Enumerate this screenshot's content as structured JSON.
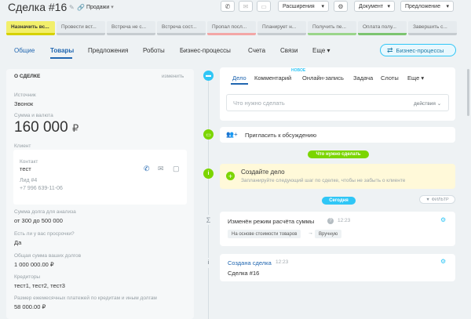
{
  "header": {
    "title": "Сделка #16",
    "funnel": "Продажи",
    "extensions": "Расширения",
    "document": "Документ",
    "proposal": "Предложение"
  },
  "stages": [
    {
      "label": "Назначить вс...",
      "bg": "#f2ef6b",
      "bar": "#d6d100",
      "color": "#333"
    },
    {
      "label": "Провести вст...",
      "bg": "#e6ebee",
      "bar": "#c6ccd0",
      "color": "#666"
    },
    {
      "label": "Встреча не с...",
      "bg": "#e6ebee",
      "bar": "#c6ccd0",
      "color": "#666"
    },
    {
      "label": "Встреча сост...",
      "bg": "#e6ebee",
      "bar": "#c6ccd0",
      "color": "#666"
    },
    {
      "label": "Пропал посл...",
      "bg": "#e6ebee",
      "bar": "#f3a6a6",
      "color": "#666"
    },
    {
      "label": "Планирует н...",
      "bg": "#e6ebee",
      "bar": "#c6ccd0",
      "color": "#666"
    },
    {
      "label": "Получить пе...",
      "bg": "#e6ebee",
      "bar": "#9ad58b",
      "color": "#666"
    },
    {
      "label": "Оплата полу...",
      "bg": "#e6ebee",
      "bar": "#7cc470",
      "color": "#666"
    },
    {
      "label": "Завершить с...",
      "bg": "#e6ebee",
      "bar": "#c6ccd0",
      "color": "#666"
    }
  ],
  "tabs": [
    "Общие",
    "Товары",
    "Предложения",
    "Роботы",
    "Бизнес-процессы",
    "Счета",
    "Связи",
    "Еще"
  ],
  "bp_button": "Бизнес-процессы",
  "left": {
    "section_title": "О СДЕЛКЕ",
    "edit": "изменить",
    "source_label": "Источник",
    "source_value": "Звонок",
    "amount_label": "Сумма и валюта",
    "amount_value": "160 000",
    "currency": "₽",
    "client_label": "Клиент",
    "contact_label": "Контакт",
    "contact_name": "тест",
    "lead": "Лид #4",
    "phone": "+7 996 639-11-06",
    "debt_label": "Сумма долга для анализа",
    "debt_value": "от 300 до 500 000",
    "overdue_label": "Есть ли у вас просрочки?",
    "overdue_value": "Да",
    "total_debt_label": "Общая сумма ваших долгов",
    "total_debt_value": "1 000 000.00 ₽",
    "creditors_label": "Кредиторы",
    "creditors_value": "тест1, тест2, тест3",
    "monthly_label": "Размер ежемесячных платежей по кредитам и иным долгам",
    "monthly_value": "58 000.00 ₽"
  },
  "editor": {
    "tabs": [
      "Дело",
      "Комментарий",
      "Онлайн-запись",
      "Задача",
      "Слоты",
      "Еще"
    ],
    "new_badge": "НОВОЕ",
    "placeholder": "Что нужно сделать",
    "actions": "действия"
  },
  "invite": "Пригласить к обсуждению",
  "chip_todo": "Что нужно сделать",
  "create_task": {
    "title": "Создайте дело",
    "subtitle": "Запланируйте следующий шаг по сделке, чтобы не забыть о клиенте"
  },
  "chip_today": "Сегодня",
  "filter": "ФИЛЬТР",
  "event1": {
    "title": "Изменён режим расчёта суммы",
    "time": "12:23",
    "from": "На основе стоимости товаров",
    "to": "Вручную"
  },
  "event2": {
    "title": "Создана сделка",
    "time": "12:23",
    "body": "Сделка #16"
  }
}
